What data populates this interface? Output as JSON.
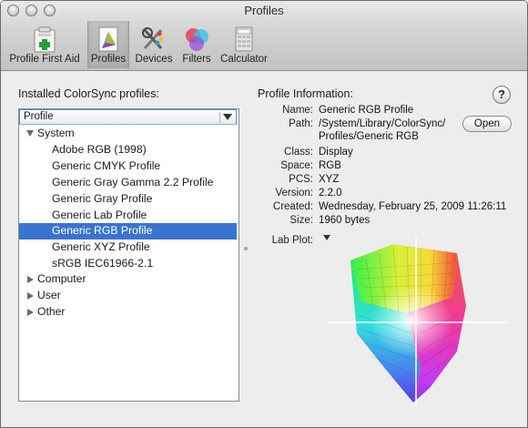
{
  "window": {
    "title": "Profiles"
  },
  "toolbar": {
    "items": [
      {
        "label": "Profile First Aid",
        "icon": "first-aid-kit-icon"
      },
      {
        "label": "Profiles",
        "icon": "profiles-icon",
        "selected": true
      },
      {
        "label": "Devices",
        "icon": "devices-tools-icon"
      },
      {
        "label": "Filters",
        "icon": "filters-color-circles-icon"
      },
      {
        "label": "Calculator",
        "icon": "calculator-icon"
      }
    ]
  },
  "profiles_panel": {
    "heading": "Installed ColorSync profiles:",
    "column_header": "Profile",
    "tree": [
      {
        "label": "System",
        "level": 0,
        "expanded": true
      },
      {
        "label": "Adobe RGB (1998)",
        "level": 1
      },
      {
        "label": "Generic CMYK Profile",
        "level": 1
      },
      {
        "label": "Generic Gray Gamma 2.2 Profile",
        "level": 1
      },
      {
        "label": "Generic Gray Profile",
        "level": 1
      },
      {
        "label": "Generic Lab Profile",
        "level": 1
      },
      {
        "label": "Generic RGB Profile",
        "level": 1,
        "selected": true
      },
      {
        "label": "Generic XYZ Profile",
        "level": 1
      },
      {
        "label": "sRGB IEC61966-2.1",
        "level": 1
      },
      {
        "label": "Computer",
        "level": 0,
        "expanded": false
      },
      {
        "label": "User",
        "level": 0,
        "expanded": false
      },
      {
        "label": "Other",
        "level": 0,
        "expanded": false
      }
    ]
  },
  "info_panel": {
    "heading": "Profile Information:",
    "help_label": "?",
    "open_label": "Open",
    "fields": {
      "name_label": "Name:",
      "name": "Generic RGB Profile",
      "path_label": "Path:",
      "path_line1": "/System/Library/ColorSync/",
      "path_line2": "Profiles/Generic RGB",
      "class_label": "Class:",
      "class": "Display",
      "space_label": "Space:",
      "space": "RGB",
      "pcs_label": "PCS:",
      "pcs": "XYZ",
      "version_label": "Version:",
      "version": "2.2.0",
      "created_label": "Created:",
      "created": "Wednesday, February 25, 2009 11:26:11",
      "size_label": "Size:",
      "size": "1960 bytes",
      "labplot_label": "Lab Plot:"
    }
  },
  "colors": {
    "selection": "#3a74d1",
    "window_bg": "#ededed"
  }
}
